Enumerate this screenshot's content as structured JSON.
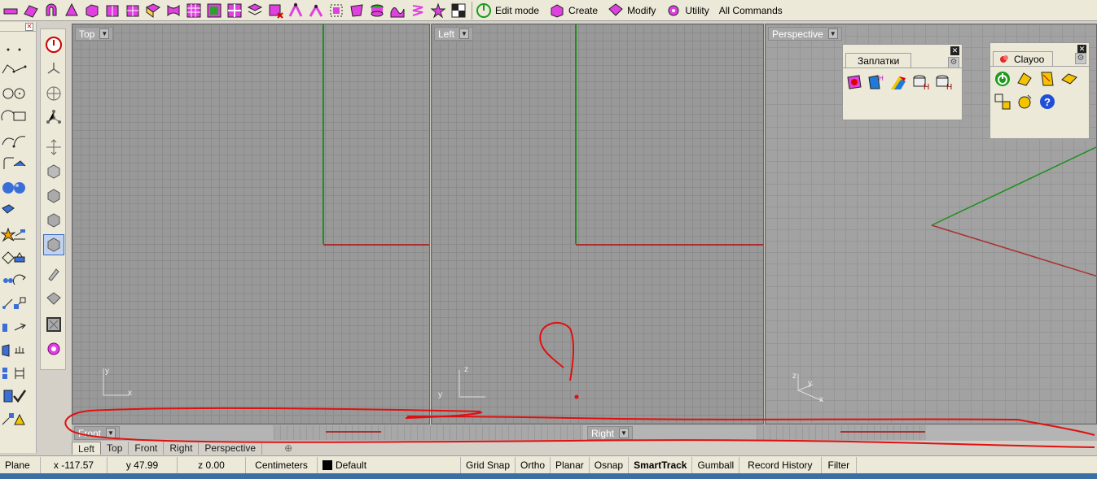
{
  "toolbar": {
    "icons": [
      "pipe-icon",
      "surface-icon",
      "magnet-icon",
      "cone-icon",
      "box-icon",
      "cube-split-icon",
      "cube-icon",
      "ribbon-icon",
      "grid-surface-icon",
      "checkbox-surface-icon",
      "patch-icon",
      "layers-icon",
      "network-icon",
      "flow-icon",
      "symmetry-icon",
      "twist-icon",
      "cage-icon",
      "drum-icon",
      "wave-icon",
      "deform-icon",
      "stars-icon",
      "spring-icon",
      "checker-icon"
    ],
    "buttons": [
      {
        "id": "edit-mode",
        "label": "Edit mode",
        "icon": "power-icon"
      },
      {
        "id": "create",
        "label": "Create",
        "icon": "create-cube-icon"
      },
      {
        "id": "modify",
        "label": "Modify",
        "icon": "modify-icon"
      },
      {
        "id": "utility",
        "label": "Utility",
        "icon": "utility-gear-icon"
      },
      {
        "id": "all-commands",
        "label": "All Commands",
        "icon": ""
      }
    ]
  },
  "viewports": {
    "top": {
      "label": "Top",
      "triad_x": "x",
      "triad_y": "y"
    },
    "left": {
      "label": "Left",
      "triad_y": "y",
      "triad_z": "z"
    },
    "perspective": {
      "label": "Perspective",
      "triad_x": "x",
      "triad_y": "y",
      "triad_z": "z"
    },
    "front": {
      "label": "Front"
    },
    "right": {
      "label": "Right"
    }
  },
  "panels": {
    "zaplatki": {
      "title": "Заплатки"
    },
    "clayoo": {
      "title": "Clayoo"
    }
  },
  "viewport_tabs": [
    "Left",
    "Top",
    "Front",
    "Right",
    "Perspective"
  ],
  "viewport_tab_active": "Left",
  "status": {
    "cplane": "Plane",
    "x": "x -117.57",
    "y": "y 47.99",
    "z": "z 0.00",
    "units": "Centimeters",
    "layer": "Default",
    "toggles": [
      "Grid Snap",
      "Ortho",
      "Planar",
      "Osnap",
      "SmartTrack",
      "Gumball",
      "Record History",
      "Filter"
    ],
    "bold_toggle": "SmartTrack"
  },
  "colors": {
    "grid_bg": "#999999",
    "x_axis": "#a83232",
    "y_axis": "#1c8f1c",
    "annotation": "#e01010"
  }
}
